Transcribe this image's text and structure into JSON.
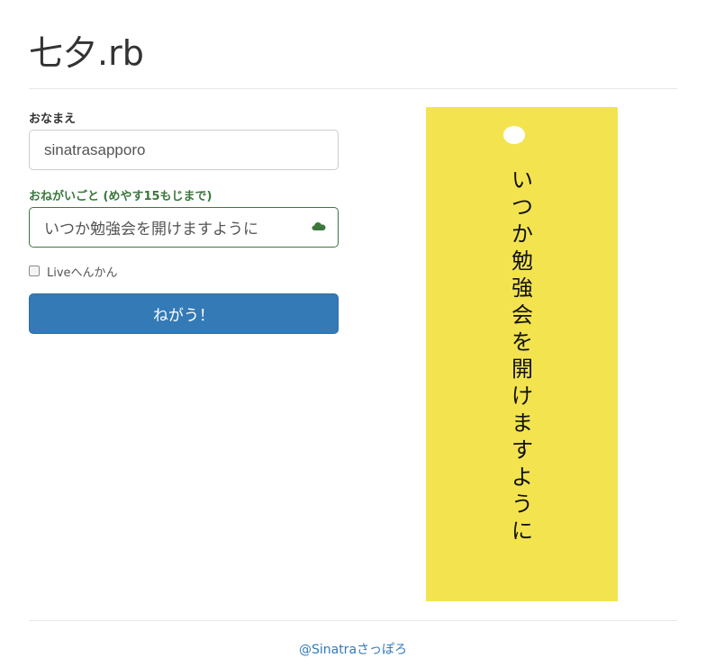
{
  "header": {
    "title": "七夕.rb"
  },
  "form": {
    "name_label": "おなまえ",
    "name_value": "sinatrasapporo",
    "wish_label": "おねがいごと (めやす15もじまで)",
    "wish_value": "いつか勉強会を開けますように",
    "wish_status_icon": "cloud-icon",
    "live_label": "Liveへんかん",
    "live_checked": false,
    "submit_label": "ねがう！"
  },
  "tanzaku": {
    "color": "#f3e44f",
    "chars": [
      "い",
      "つ",
      "か",
      "勉",
      "強",
      "会",
      "を",
      "開",
      "け",
      "ま",
      "す",
      "よ",
      "う",
      "に"
    ]
  },
  "footer": {
    "link_text": "@Sinatraさっぽろ"
  },
  "colors": {
    "primary": "#337ab7",
    "success": "#3c763d"
  }
}
